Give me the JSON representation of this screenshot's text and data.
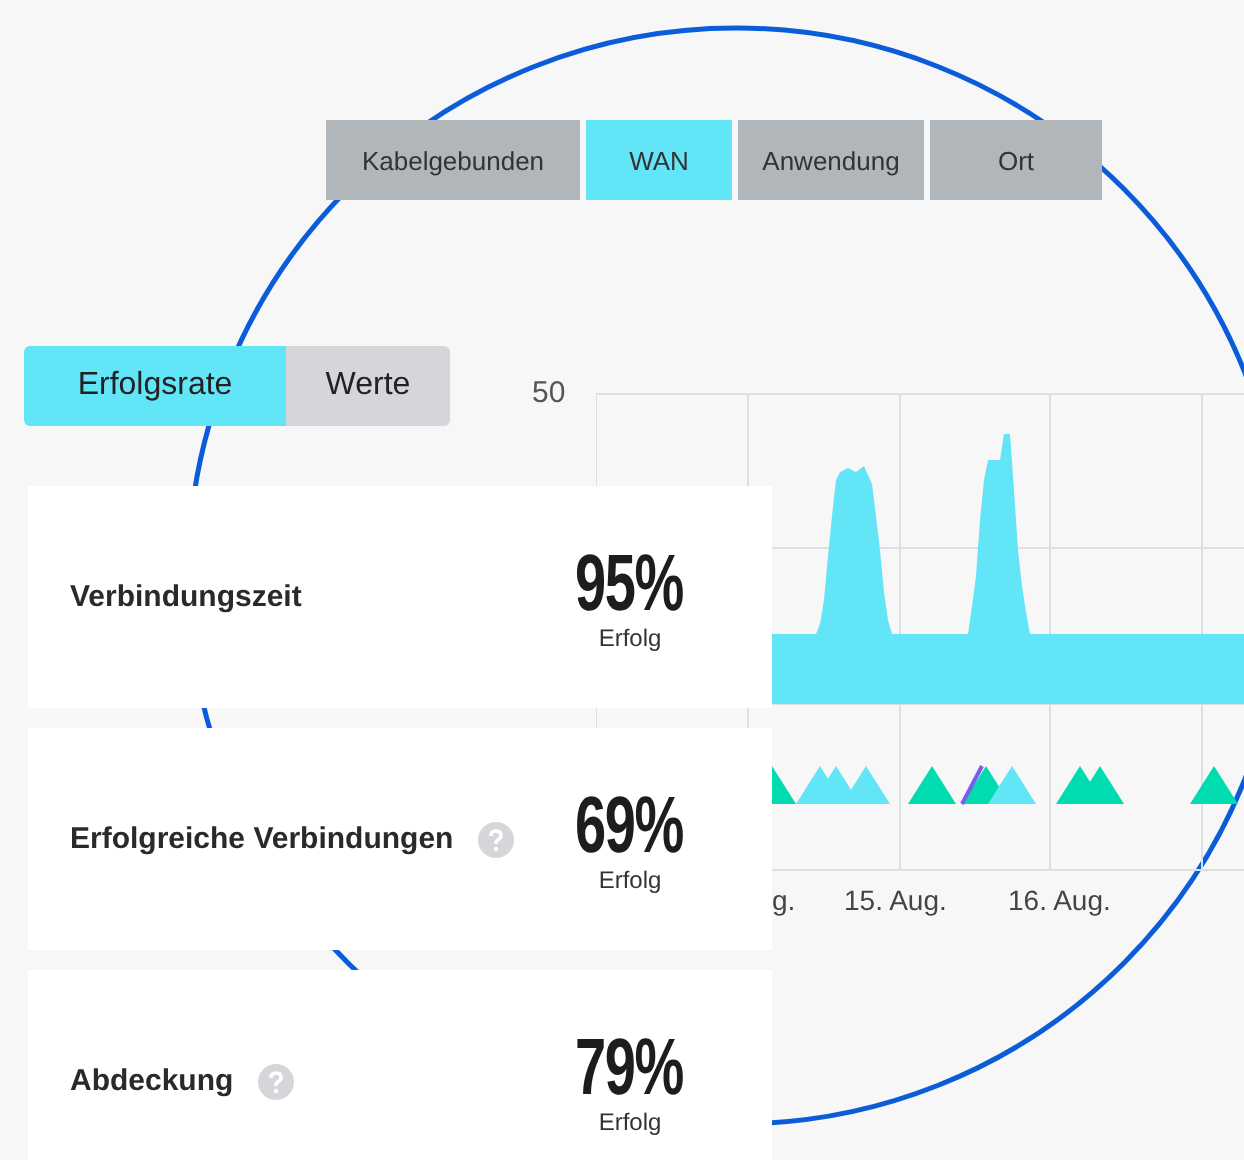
{
  "tabs": [
    {
      "label": "Kabelgebunden",
      "selected": false
    },
    {
      "label": "WAN",
      "selected": true
    },
    {
      "label": "Anwendung",
      "selected": false
    },
    {
      "label": "Ort",
      "selected": false
    }
  ],
  "toggle": [
    {
      "label": "Erfolgsrate",
      "selected": true
    },
    {
      "label": "Werte",
      "selected": false
    }
  ],
  "chart": {
    "y_label": "50",
    "x_labels": [
      "g.",
      "15. Aug.",
      "16. Aug."
    ]
  },
  "metrics": [
    {
      "name": "Verbindungszeit",
      "help": false,
      "value": "95%",
      "caption": "Erfolg"
    },
    {
      "name": "Erfolgreiche Verbindungen",
      "help": true,
      "value": "69%",
      "caption": "Erfolg"
    },
    {
      "name": "Abdeckung",
      "help": true,
      "value": "79%",
      "caption": "Erfolg"
    }
  ]
}
